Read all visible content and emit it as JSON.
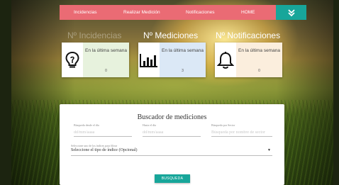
{
  "navbar": {
    "items": [
      "Incidencias",
      "Realizar Medición",
      "Notificaciones",
      "HOME"
    ],
    "menu_icon": "double-chevron-down-icon",
    "color": "#ea6b74",
    "accent": "#17a69a"
  },
  "stats": [
    {
      "heading": "Nº Incidencias",
      "label": "En la última semana",
      "value": "0",
      "icon": "lightbulb-icon",
      "tint": "#e7f2dd"
    },
    {
      "heading": "Nº Mediciones",
      "label": "En la última semana",
      "value": "3",
      "icon": "bar-chart-icon",
      "tint": "#dbe8f6"
    },
    {
      "heading": "Nº Notificaciones",
      "label": "En la última semana",
      "value": "0",
      "icon": "bell-icon",
      "tint": "#fbeedd"
    }
  ],
  "search": {
    "title": "Buscador de mediciones",
    "from_label": "Búsqueda desde el día",
    "from_placeholder": "dd/mm/aaaa",
    "to_label": "Hasta el día",
    "to_placeholder": "dd/mm/aaaa",
    "sector_label": "Búsqueda por Sector",
    "sector_placeholder": "Búsqueda por nombre de sector",
    "index_label": "Seleccione uno de los índices para filtrar",
    "index_value": "Seleccione el tipo de índice (Opcional)",
    "button": "BUSQUEDA"
  }
}
